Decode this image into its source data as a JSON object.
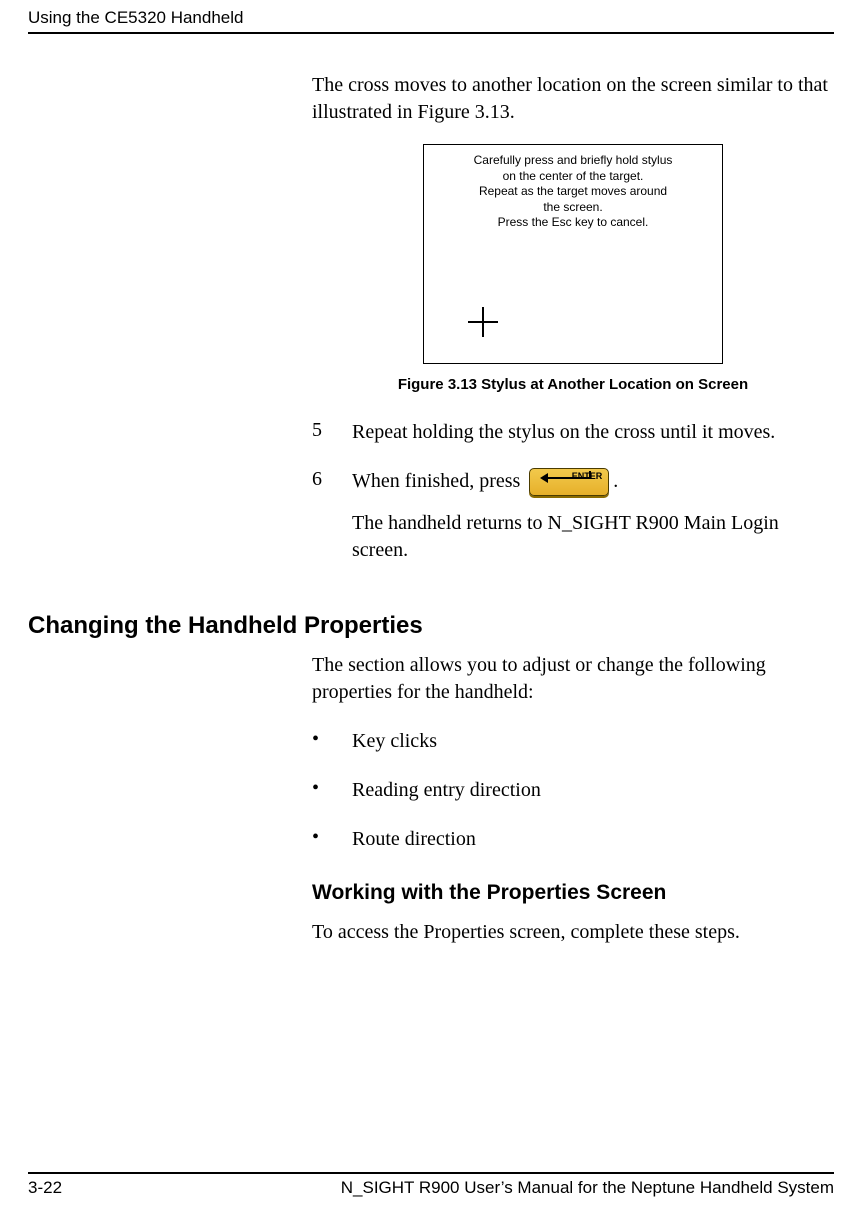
{
  "header": {
    "title": "Using the CE5320 Handheld"
  },
  "intro_paragraph": "The cross moves to another location on the screen similar to that illustrated in Figure 3.13.",
  "calibration_screen": {
    "line1": "Carefully press and briefly hold stylus",
    "line2": "on the center of the target.",
    "line3": "Repeat as the target moves around",
    "line4": "the screen.",
    "line5": "Press the Esc key to cancel."
  },
  "figure_caption": "Figure 3.13   Stylus at Another Location on Screen",
  "steps": {
    "s5_num": "5",
    "s5_text": "Repeat holding the stylus on the cross until it moves.",
    "s6_num": "6",
    "s6_prefix": "When finished, press ",
    "s6_suffix": ".",
    "enter_label": "ENTER",
    "post_text": "The handheld returns to N_SIGHT R900 Main Login screen."
  },
  "section_changing": {
    "heading": "Changing the Handheld Properties",
    "intro": "The section allows you to adjust or change the following properties for the handheld:",
    "bullets": {
      "b1": "Key clicks",
      "b2": "Reading entry direction",
      "b3": "Route direction"
    }
  },
  "section_working": {
    "heading": "Working with the Properties Screen",
    "intro": "To access the Properties screen, complete these steps."
  },
  "footer": {
    "page_num": "3-22",
    "doc_title": "N_SIGHT R900 User’s Manual for the Neptune Handheld System"
  }
}
